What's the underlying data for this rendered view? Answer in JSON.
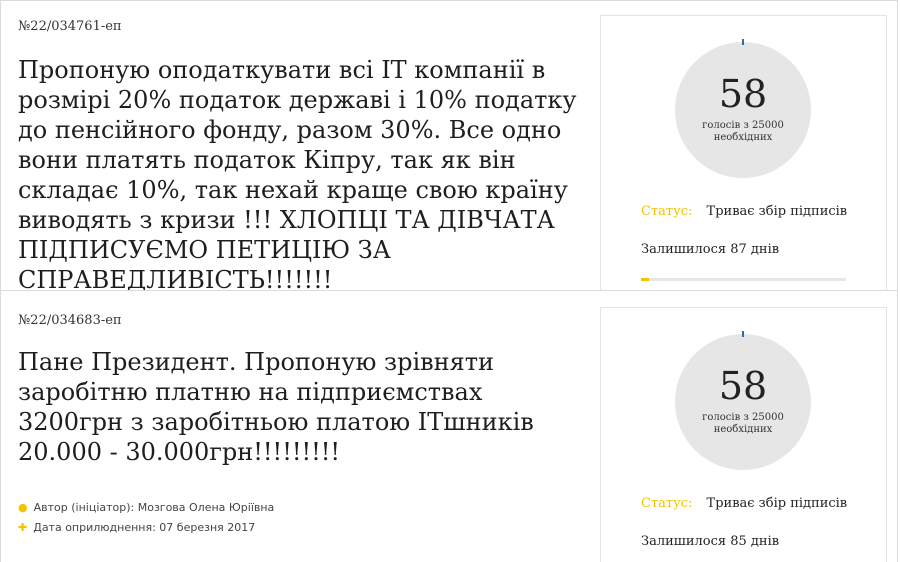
{
  "petitions": [
    {
      "number": "№22/034761-еп",
      "title": "Пропоную оподаткувати всі IT компанії в розмірі 20% податок державі і 10% податку до пенсійного фонду, разом 30%. Все одно вони платять податок Кіпру, так як він складає 10%, так нехай краще свою країну виводять з кризи !!! ХЛОПЦІ ТА ДІВЧАТА ПІДПИСУЄМО ПЕТИЦІЮ ЗА СПРАВЕДЛИВІСТЬ!!!!!!!",
      "votes": "58",
      "votes_needed": "голосів з 25000 необхідних",
      "status_label": "Статус:",
      "status_value": "Триває збір підписів",
      "remaining": "Залишилося 87 днів",
      "progress": 0.04
    },
    {
      "number": "№22/034683-еп",
      "title": "Пане Президент. Пропоную зрівняти заробітню платню на підприємствах 3200грн з заробітньою платою ІТшників 20.000 - 30.000грн!!!!!!!!!",
      "author_label": "Автор (ініціатор): Мозгова Олена Юріївна",
      "date_label": "Дата оприлюднення: 07 березня 2017",
      "votes": "58",
      "votes_needed": "голосів з 25000 необхідних",
      "status_label": "Статус:",
      "status_value": "Триває збір підписів",
      "remaining": "Залишилося 85 днів"
    }
  ],
  "colors": {
    "accent": "#f3c300",
    "circle": "#e6e6e6",
    "tick": "#2d6bb5"
  },
  "icons": {
    "author": "user-icon",
    "date": "plus-icon"
  }
}
